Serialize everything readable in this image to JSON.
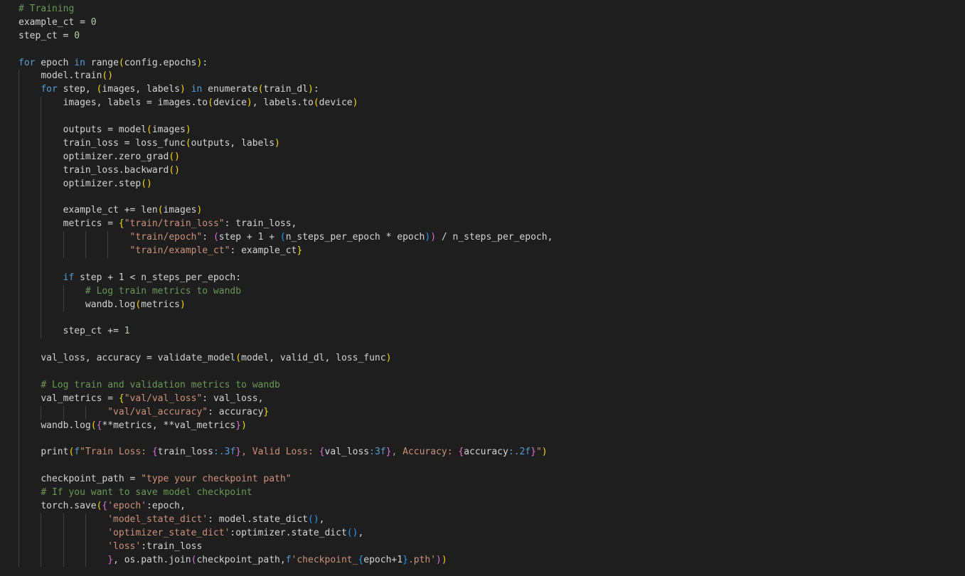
{
  "editor": {
    "colors": {
      "background": "#1e1e1e",
      "default": "#d4d4d4",
      "keyword": "#569cd6",
      "function": "#dcdcaa",
      "variable": "#9cdcfe",
      "string": "#ce9178",
      "number": "#b5cea8",
      "comment": "#6a9955",
      "bracket_1": "#ffd700",
      "bracket_2": "#da70d6",
      "bracket_3": "#179fff"
    },
    "lines": [
      {
        "indent": 0,
        "tokens": [
          [
            "cm",
            "# Training"
          ]
        ]
      },
      {
        "indent": 0,
        "tokens": [
          [
            "def",
            "example_ct = "
          ],
          [
            "num",
            "0"
          ]
        ]
      },
      {
        "indent": 0,
        "tokens": [
          [
            "def",
            "step_ct = "
          ],
          [
            "num",
            "0"
          ]
        ]
      },
      {
        "indent": 0,
        "tokens": []
      },
      {
        "indent": 0,
        "tokens": [
          [
            "kw",
            "for"
          ],
          [
            "def",
            " epoch "
          ],
          [
            "kw",
            "in"
          ],
          [
            "def",
            " range"
          ],
          [
            "p1",
            "("
          ],
          [
            "def",
            "config.epochs"
          ],
          [
            "p1",
            ")"
          ],
          [
            "def",
            ":"
          ]
        ]
      },
      {
        "indent": 1,
        "tokens": [
          [
            "def",
            "model.train"
          ],
          [
            "p1",
            "()"
          ]
        ]
      },
      {
        "indent": 1,
        "tokens": [
          [
            "kw",
            "for"
          ],
          [
            "def",
            " step, "
          ],
          [
            "p1",
            "("
          ],
          [
            "def",
            "images, labels"
          ],
          [
            "p1",
            ")"
          ],
          [
            "def",
            " "
          ],
          [
            "kw",
            "in"
          ],
          [
            "def",
            " enumerate"
          ],
          [
            "p1",
            "("
          ],
          [
            "def",
            "train_dl"
          ],
          [
            "p1",
            ")"
          ],
          [
            "def",
            ":"
          ]
        ]
      },
      {
        "indent": 2,
        "tokens": [
          [
            "def",
            "images, labels = images.to"
          ],
          [
            "p1",
            "("
          ],
          [
            "def",
            "device"
          ],
          [
            "p1",
            ")"
          ],
          [
            "def",
            ", labels.to"
          ],
          [
            "p1",
            "("
          ],
          [
            "def",
            "device"
          ],
          [
            "p1",
            ")"
          ]
        ]
      },
      {
        "indent": 2,
        "tokens": []
      },
      {
        "indent": 2,
        "tokens": [
          [
            "def",
            "outputs = model"
          ],
          [
            "p1",
            "("
          ],
          [
            "def",
            "images"
          ],
          [
            "p1",
            ")"
          ]
        ]
      },
      {
        "indent": 2,
        "tokens": [
          [
            "def",
            "train_loss = loss_func"
          ],
          [
            "p1",
            "("
          ],
          [
            "def",
            "outputs, labels"
          ],
          [
            "p1",
            ")"
          ]
        ]
      },
      {
        "indent": 2,
        "tokens": [
          [
            "def",
            "optimizer.zero_grad"
          ],
          [
            "p1",
            "()"
          ]
        ]
      },
      {
        "indent": 2,
        "tokens": [
          [
            "def",
            "train_loss.backward"
          ],
          [
            "p1",
            "()"
          ]
        ]
      },
      {
        "indent": 2,
        "tokens": [
          [
            "def",
            "optimizer.step"
          ],
          [
            "p1",
            "()"
          ]
        ]
      },
      {
        "indent": 2,
        "tokens": []
      },
      {
        "indent": 2,
        "tokens": [
          [
            "def",
            "example_ct += len"
          ],
          [
            "p1",
            "("
          ],
          [
            "def",
            "images"
          ],
          [
            "p1",
            ")"
          ]
        ]
      },
      {
        "indent": 2,
        "tokens": [
          [
            "def",
            "metrics = "
          ],
          [
            "p1",
            "{"
          ],
          [
            "str",
            "\"train/train_loss\""
          ],
          [
            "def",
            ": train_loss,"
          ]
        ]
      },
      {
        "indent": 5,
        "tokens": [
          [
            "str",
            "\"train/epoch\""
          ],
          [
            "def",
            ": "
          ],
          [
            "p2",
            "("
          ],
          [
            "def",
            "step + 1 + "
          ],
          [
            "p3",
            "("
          ],
          [
            "def",
            "n_steps_per_epoch * epoch"
          ],
          [
            "p3",
            ")"
          ],
          [
            "p2",
            ")"
          ],
          [
            "def",
            " / n_steps_per_epoch,"
          ]
        ]
      },
      {
        "indent": 5,
        "tokens": [
          [
            "str",
            "\"train/example_ct\""
          ],
          [
            "def",
            ": example_ct"
          ],
          [
            "p1",
            "}"
          ]
        ]
      },
      {
        "indent": 2,
        "tokens": []
      },
      {
        "indent": 2,
        "tokens": [
          [
            "kw",
            "if"
          ],
          [
            "def",
            " step + 1 < n_steps_per_epoch:"
          ]
        ]
      },
      {
        "indent": 3,
        "tokens": [
          [
            "cm",
            "# Log train metrics to wandb"
          ]
        ]
      },
      {
        "indent": 3,
        "tokens": [
          [
            "def",
            "wandb.log"
          ],
          [
            "p1",
            "("
          ],
          [
            "def",
            "metrics"
          ],
          [
            "p1",
            ")"
          ]
        ]
      },
      {
        "indent": 2,
        "tokens": []
      },
      {
        "indent": 2,
        "tokens": [
          [
            "def",
            "step_ct += "
          ],
          [
            "num",
            "1"
          ]
        ]
      },
      {
        "indent": 1,
        "tokens": []
      },
      {
        "indent": 1,
        "tokens": [
          [
            "def",
            "val_loss, accuracy = validate_model"
          ],
          [
            "p1",
            "("
          ],
          [
            "def",
            "model, valid_dl, loss_func"
          ],
          [
            "p1",
            ")"
          ]
        ]
      },
      {
        "indent": 1,
        "tokens": []
      },
      {
        "indent": 1,
        "tokens": [
          [
            "cm",
            "# Log train and validation metrics to wandb"
          ]
        ]
      },
      {
        "indent": 1,
        "tokens": [
          [
            "def",
            "val_metrics = "
          ],
          [
            "p1",
            "{"
          ],
          [
            "str",
            "\"val/val_loss\""
          ],
          [
            "def",
            ": val_loss,"
          ]
        ]
      },
      {
        "indent": 4,
        "tokens": [
          [
            "str",
            "\"val/val_accuracy\""
          ],
          [
            "def",
            ": accuracy"
          ],
          [
            "p1",
            "}"
          ]
        ]
      },
      {
        "indent": 1,
        "tokens": [
          [
            "def",
            "wandb.log"
          ],
          [
            "p1",
            "("
          ],
          [
            "p2",
            "{"
          ],
          [
            "def",
            "**metrics, **val_metrics"
          ],
          [
            "p2",
            "}"
          ],
          [
            "p1",
            ")"
          ]
        ]
      },
      {
        "indent": 1,
        "tokens": []
      },
      {
        "indent": 1,
        "tokens": [
          [
            "def",
            "print"
          ],
          [
            "p1",
            "("
          ],
          [
            "kw",
            "f"
          ],
          [
            "str",
            "\"Train Loss: "
          ],
          [
            "p2",
            "{"
          ],
          [
            "def",
            "train_loss"
          ],
          [
            "kw",
            ":.3f"
          ],
          [
            "p2",
            "}"
          ],
          [
            "str",
            ", Valid Loss: "
          ],
          [
            "p2",
            "{"
          ],
          [
            "def",
            "val_loss"
          ],
          [
            "kw",
            ":3f"
          ],
          [
            "p2",
            "}"
          ],
          [
            "str",
            ", Accuracy: "
          ],
          [
            "p2",
            "{"
          ],
          [
            "def",
            "accuracy"
          ],
          [
            "kw",
            ":.2f"
          ],
          [
            "p2",
            "}"
          ],
          [
            "str",
            "\""
          ],
          [
            "p1",
            ")"
          ]
        ]
      },
      {
        "indent": 1,
        "tokens": []
      },
      {
        "indent": 1,
        "tokens": [
          [
            "def",
            "checkpoint_path = "
          ],
          [
            "str",
            "\"type your checkpoint path\""
          ]
        ]
      },
      {
        "indent": 1,
        "tokens": [
          [
            "cm",
            "# If you want to save model checkpoint"
          ]
        ]
      },
      {
        "indent": 1,
        "tokens": [
          [
            "def",
            "torch.save"
          ],
          [
            "p1",
            "("
          ],
          [
            "p2",
            "{"
          ],
          [
            "str",
            "'epoch'"
          ],
          [
            "def",
            ":epoch,"
          ]
        ]
      },
      {
        "indent": 4,
        "tokens": [
          [
            "str",
            "'model_state_dict'"
          ],
          [
            "def",
            ": model.state_dict"
          ],
          [
            "p3",
            "()"
          ],
          [
            "def",
            ","
          ]
        ]
      },
      {
        "indent": 4,
        "tokens": [
          [
            "str",
            "'optimizer_state_dict'"
          ],
          [
            "def",
            ":optimizer.state_dict"
          ],
          [
            "p3",
            "()"
          ],
          [
            "def",
            ","
          ]
        ]
      },
      {
        "indent": 4,
        "tokens": [
          [
            "str",
            "'loss'"
          ],
          [
            "def",
            ":train_loss"
          ]
        ]
      },
      {
        "indent": 4,
        "tokens": [
          [
            "p2",
            "}"
          ],
          [
            "def",
            ", os.path.join"
          ],
          [
            "p2",
            "("
          ],
          [
            "def",
            "checkpoint_path,"
          ],
          [
            "kw",
            "f"
          ],
          [
            "str",
            "'checkpoint_"
          ],
          [
            "p3",
            "{"
          ],
          [
            "def",
            "epoch+1"
          ],
          [
            "p3",
            "}"
          ],
          [
            "str",
            ".pth'"
          ],
          [
            "p2",
            ")"
          ],
          [
            "p1",
            ")"
          ]
        ]
      }
    ]
  }
}
